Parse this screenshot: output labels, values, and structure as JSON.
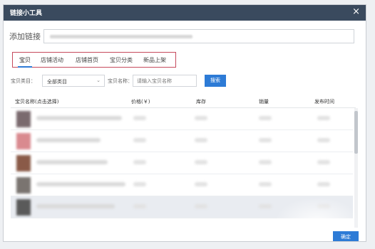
{
  "dialog": {
    "title": "链接小工具",
    "close_symbol": "×"
  },
  "link": {
    "label": "添加链接"
  },
  "tabs": [
    {
      "label": "宝贝",
      "active": true
    },
    {
      "label": "店铺活动"
    },
    {
      "label": "店铺首页"
    },
    {
      "label": "宝贝分类"
    },
    {
      "label": "新品上架"
    }
  ],
  "filters": {
    "category_label": "宝贝类目：",
    "category_value": "全部类目",
    "name_label": "宝贝名称：",
    "name_placeholder": "请输入宝贝名称",
    "search_label": "搜索"
  },
  "table": {
    "headers": [
      "宝贝名称(点击选择)",
      "价格(￥)",
      "库存",
      "销量",
      "发布时间"
    ]
  },
  "rows": [
    {
      "thumb_color": "#7a6a6e"
    },
    {
      "thumb_color": "#d98a8f"
    },
    {
      "thumb_color": "#8a5a48"
    },
    {
      "thumb_color": "#7a7470"
    },
    {
      "thumb_color": "#5a5a5a"
    }
  ],
  "footer": {
    "confirm_label": "确定"
  },
  "colors": {
    "titlebar": "#3a4a5e",
    "accent": "#2d7bd6",
    "tabs_border": "#c64a5c"
  }
}
